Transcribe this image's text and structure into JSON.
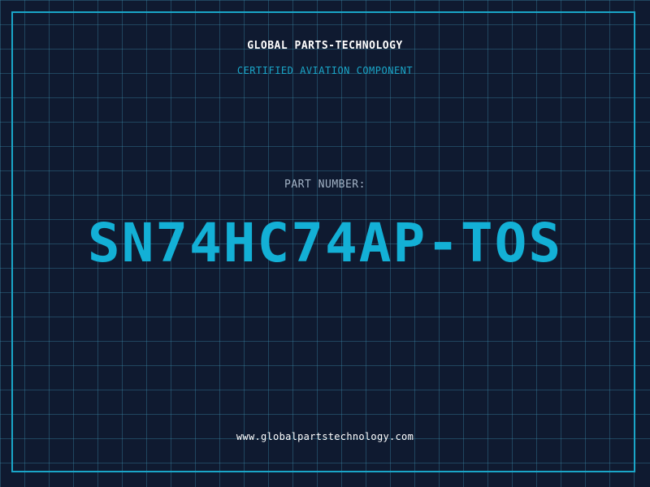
{
  "header": {
    "company": "GLOBAL PARTS-TECHNOLOGY",
    "tagline": "CERTIFIED AVIATION COMPONENT"
  },
  "part": {
    "label": "PART NUMBER:",
    "number": "SN74HC74AP-TOS"
  },
  "footer": {
    "website": "www.globalpartstechnology.com"
  },
  "colors": {
    "background": "#0f1a30",
    "accent": "#13b0d6",
    "grid": "#3c8caa"
  }
}
